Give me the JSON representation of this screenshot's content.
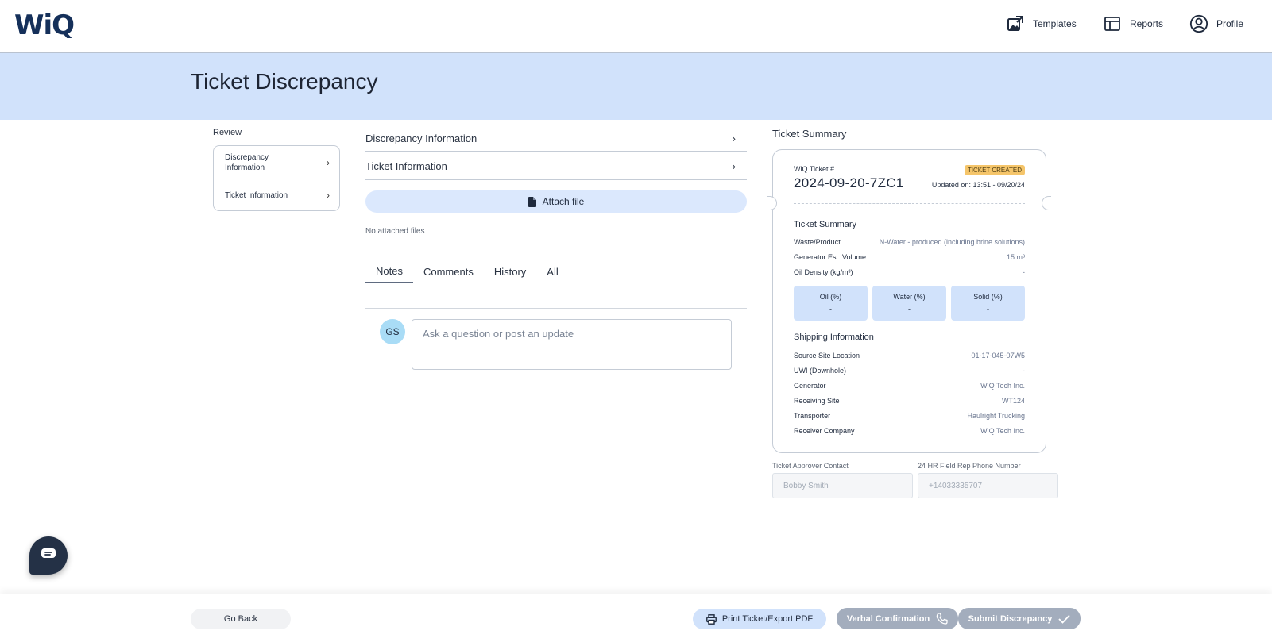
{
  "header": {
    "logo": "WiQ",
    "nav": [
      {
        "label": "Templates",
        "icon": "templates-icon"
      },
      {
        "label": "Reports",
        "icon": "reports-icon"
      },
      {
        "label": "Profile",
        "icon": "profile-icon"
      }
    ]
  },
  "page": {
    "title": "Ticket Discrepancy"
  },
  "review": {
    "label": "Review",
    "items": [
      {
        "label": "Discrepancy Information"
      },
      {
        "label": "Ticket Information"
      }
    ]
  },
  "main": {
    "accordions": [
      {
        "label": "Discrepancy Information"
      },
      {
        "label": "Ticket Information"
      }
    ],
    "attach_label": "Attach file",
    "no_files": "No attached files",
    "tabs": [
      {
        "label": "Notes",
        "active": true
      },
      {
        "label": "Comments"
      },
      {
        "label": "History"
      },
      {
        "label": "All"
      }
    ],
    "avatar_initials": "GS",
    "note_placeholder": "Ask a question or post an update",
    "note_value": ""
  },
  "summary": {
    "heading": "Ticket Summary",
    "ticket_label": "WiQ Ticket #",
    "ticket_number": "2024-09-20-7ZC1",
    "status": "TICKET CREATED",
    "status_color": "#f5c56a",
    "updated": "Updated on: 13:51 - 09/20/24",
    "section1_title": "Ticket Summary",
    "rows1": [
      {
        "k": "Waste/Product",
        "v": "N-Water - produced (including brine solutions)"
      },
      {
        "k": "Generator Est. Volume",
        "v": "15 m³"
      },
      {
        "k": "Oil Density (kg/m³)",
        "v": "-"
      }
    ],
    "percents": [
      {
        "k": "Oil (%)",
        "v": "-"
      },
      {
        "k": "Water (%)",
        "v": "-"
      },
      {
        "k": "Solid (%)",
        "v": "-"
      }
    ],
    "section2_title": "Shipping Information",
    "rows2": [
      {
        "k": "Source Site Location",
        "v": "01-17-045-07W5"
      },
      {
        "k": "UWI (Downhole)",
        "v": "-"
      },
      {
        "k": "Generator",
        "v": "WiQ Tech Inc."
      },
      {
        "k": "Receiving Site",
        "v": "WT124"
      },
      {
        "k": "Transporter",
        "v": "Haulright Trucking"
      },
      {
        "k": "Receiver Company",
        "v": "WiQ Tech Inc."
      }
    ]
  },
  "contacts": {
    "approver_label": "Ticket Approver Contact",
    "approver_value": "Bobby Smith",
    "fieldrep_label": "24 HR Field Rep Phone Number",
    "fieldrep_value": "+14033335707"
  },
  "footer": {
    "go_back": "Go Back",
    "print": "Print Ticket/Export PDF",
    "verbal": "Verbal Confirmation",
    "submit": "Submit Discrepancy"
  },
  "colors": {
    "brand": "#15305a",
    "banner": "#d1e2fb",
    "disabled_button": "#a3adbd"
  }
}
